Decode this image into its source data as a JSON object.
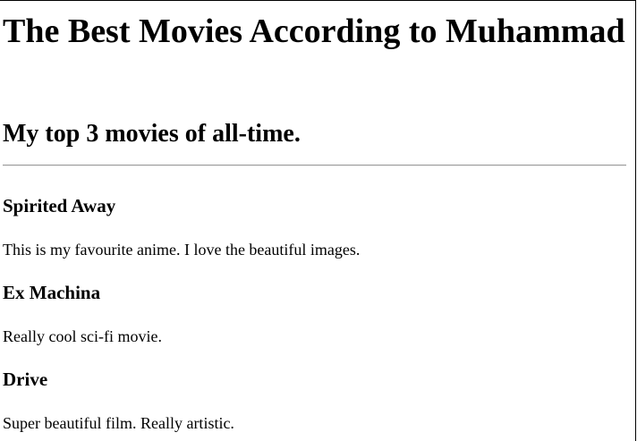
{
  "page": {
    "title": "The Best Movies According to Muhammad",
    "subtitle": "My top 3 movies of all-time."
  },
  "movies": [
    {
      "title": "Spirited Away",
      "description": "This is my favourite anime. I love the beautiful images."
    },
    {
      "title": "Ex Machina",
      "description": "Really cool sci-fi movie."
    },
    {
      "title": "Drive",
      "description": "Super beautiful film. Really artistic."
    }
  ]
}
